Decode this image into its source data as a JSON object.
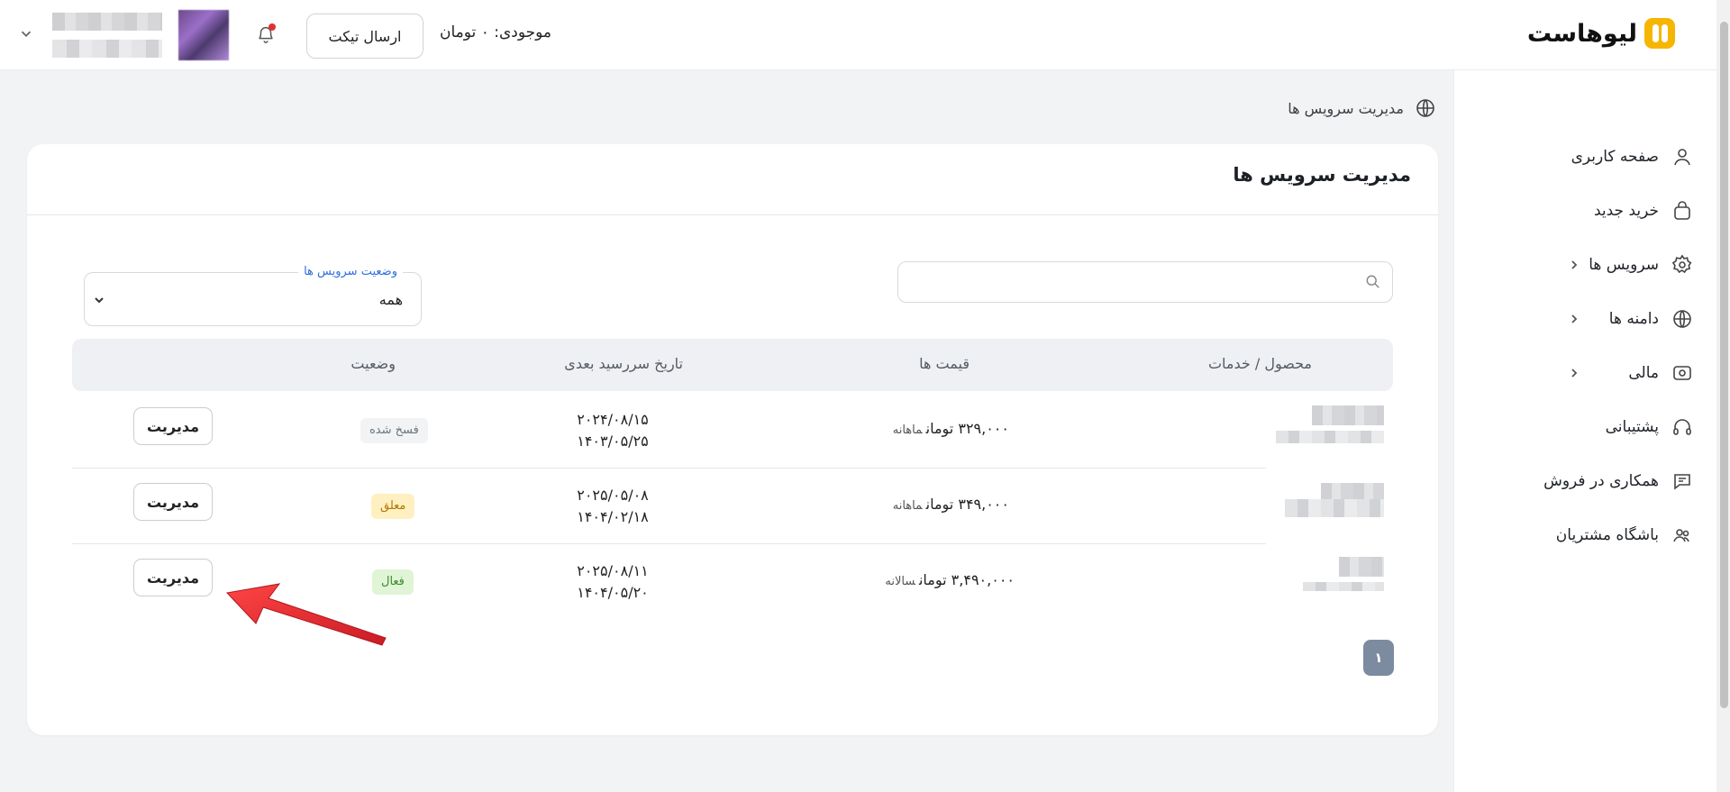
{
  "header": {
    "logo_text": "لیوهاست",
    "balance": "موجودی: ۰ تومان",
    "send_ticket_label": "ارسال تیکت"
  },
  "sidebar": {
    "items": [
      {
        "label": "صفحه کاربری",
        "icon": "user-icon"
      },
      {
        "label": "خرید جدید",
        "icon": "bag-icon"
      },
      {
        "label": "سرویس ها",
        "icon": "gear-icon",
        "has_submenu": true
      },
      {
        "label": "دامنه ها",
        "icon": "globe-icon",
        "has_submenu": true
      },
      {
        "label": "مالی",
        "icon": "money-icon",
        "has_submenu": true
      },
      {
        "label": "پشتیبانی",
        "icon": "headset-icon"
      },
      {
        "label": "همکاری در فروش",
        "icon": "chat-icon"
      },
      {
        "label": "باشگاه مشتریان",
        "icon": "users-icon"
      }
    ]
  },
  "breadcrumb": {
    "label": "مدیریت سرویس ها"
  },
  "card": {
    "title": "مدیریت سرویس ها",
    "search": {
      "placeholder": ""
    },
    "status_filter": {
      "legend": "وضعیت سرویس ها",
      "value": "همه"
    },
    "columns": [
      "محصول / خدمات",
      "قیمت ها",
      "تاریخ سررسید بعدی",
      "وضعیت"
    ],
    "rows": [
      {
        "price": "۳۲۹,۰۰۰ تومان",
        "cycle": "ماهانه",
        "date1": "۲۰۲۴/۰۸/۱۵",
        "date2": "۱۴۰۳/۰۵/۲۵",
        "status": "فسخ شده",
        "action": "مدیریت"
      },
      {
        "price": "۳۴۹,۰۰۰ تومان",
        "cycle": "ماهانه",
        "date1": "۲۰۲۵/۰۵/۰۸",
        "date2": "۱۴۰۴/۰۲/۱۸",
        "status": "معلق",
        "action": "مدیریت"
      },
      {
        "price": "۳,۴۹۰,۰۰۰ تومان",
        "cycle": "سالانه",
        "date1": "۲۰۲۵/۰۸/۱۱",
        "date2": "۱۴۰۴/۰۵/۲۰",
        "status": "فعال",
        "action": "مدیریت"
      }
    ],
    "pagination": {
      "current_page": "۱"
    }
  },
  "colors": {
    "accent_blue": "#2f6fde",
    "logo_yellow": "#f6b600",
    "status_cancelled_bg": "#f1f3f5",
    "status_suspended_bg": "#fff0c2",
    "status_active_bg": "#dff5d6",
    "annotation_arrow": "#e8232a"
  }
}
